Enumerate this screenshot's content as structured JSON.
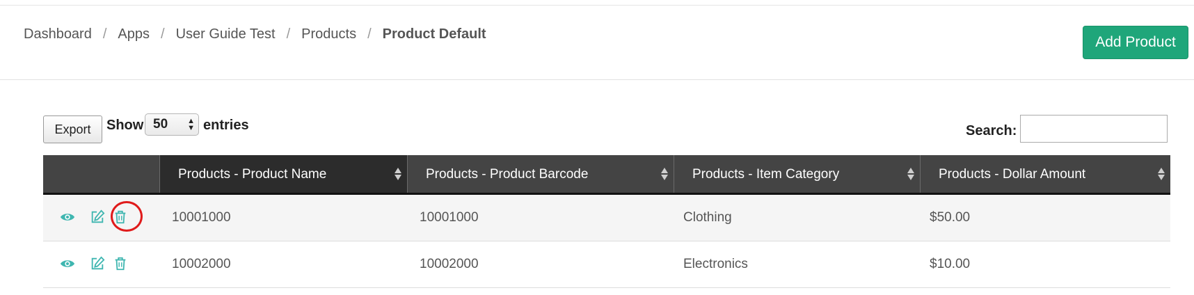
{
  "breadcrumb": {
    "items": [
      "Dashboard",
      "Apps",
      "User Guide Test",
      "Products"
    ],
    "current": "Product Default",
    "separator": "/"
  },
  "header": {
    "add_button_label": "Add Product",
    "add_button_color": "#1fa67a"
  },
  "controls": {
    "export_label": "Export",
    "show_label": "Show",
    "entries_value": "50",
    "entries_label": "entries",
    "search_label": "Search:",
    "search_value": ""
  },
  "table": {
    "columns": [
      "Products - Product Name",
      "Products - Product Barcode",
      "Products - Item Category",
      "Products - Dollar Amount"
    ],
    "rows": [
      {
        "name": "10001000",
        "barcode": "10001000",
        "category": "Clothing",
        "amount": "$50.00"
      },
      {
        "name": "10002000",
        "barcode": "10002000",
        "category": "Electronics",
        "amount": "$10.00"
      }
    ],
    "row_actions": [
      "eye-icon",
      "edit-icon",
      "trash-icon"
    ],
    "action_icon_color": "#3fb6b0",
    "highlighted_action": "trash-icon",
    "highlight_color": "#e01b1b"
  }
}
